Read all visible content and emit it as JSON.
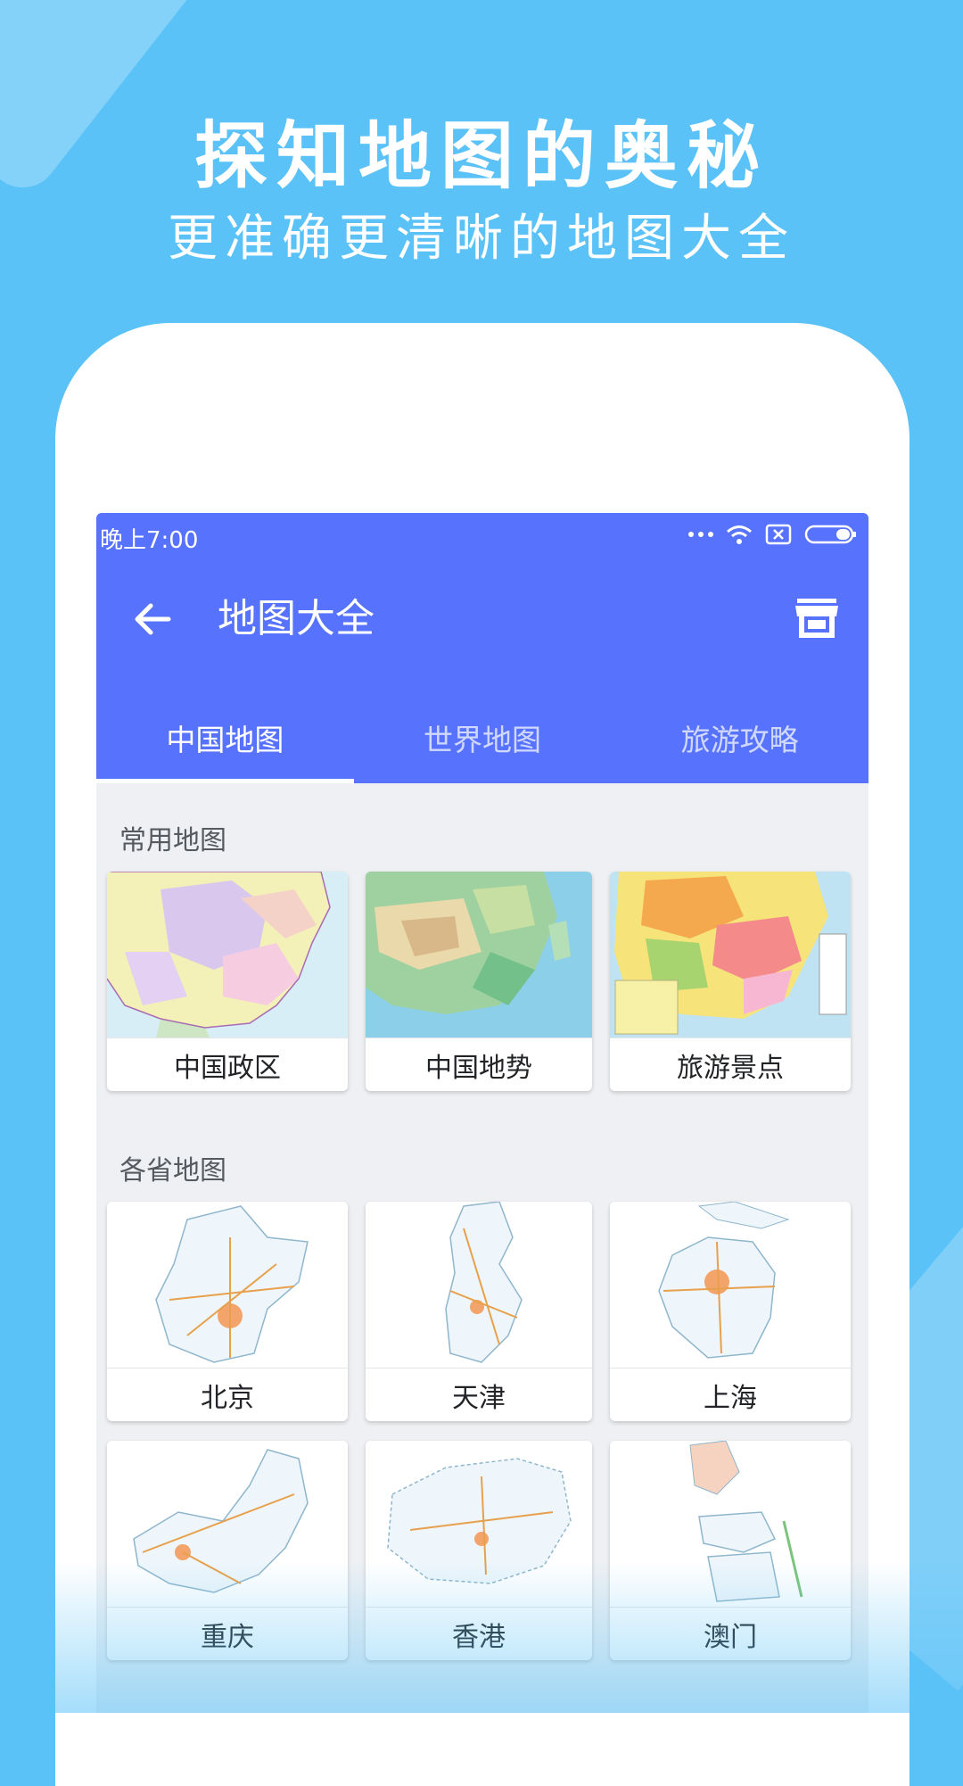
{
  "promo": {
    "title": "探知地图的奥秘",
    "subtitle": "更准确更清晰的地图大全"
  },
  "status_bar": {
    "time": "晚上7:00",
    "icons": [
      "more-dots-icon",
      "wifi-icon",
      "sim-x-icon",
      "battery-icon"
    ]
  },
  "app_bar": {
    "title": "地图大全",
    "back_icon": "arrow-left-icon",
    "store_icon": "store-icon"
  },
  "tabs": [
    {
      "label": "中国地图",
      "active": true
    },
    {
      "label": "世界地图",
      "active": false
    },
    {
      "label": "旅游攻略",
      "active": false
    }
  ],
  "sections": [
    {
      "title": "常用地图",
      "items": [
        {
          "label": "中国政区"
        },
        {
          "label": "中国地势"
        },
        {
          "label": "旅游景点"
        }
      ]
    },
    {
      "title": "各省地图",
      "items": [
        {
          "label": "北京"
        },
        {
          "label": "天津"
        },
        {
          "label": "上海"
        },
        {
          "label": "重庆"
        },
        {
          "label": "香港"
        },
        {
          "label": "澳门"
        }
      ]
    }
  ],
  "colors": {
    "background": "#5bc2f7",
    "app_bar": "#5773fe",
    "screen_bg": "#eef0f3"
  }
}
